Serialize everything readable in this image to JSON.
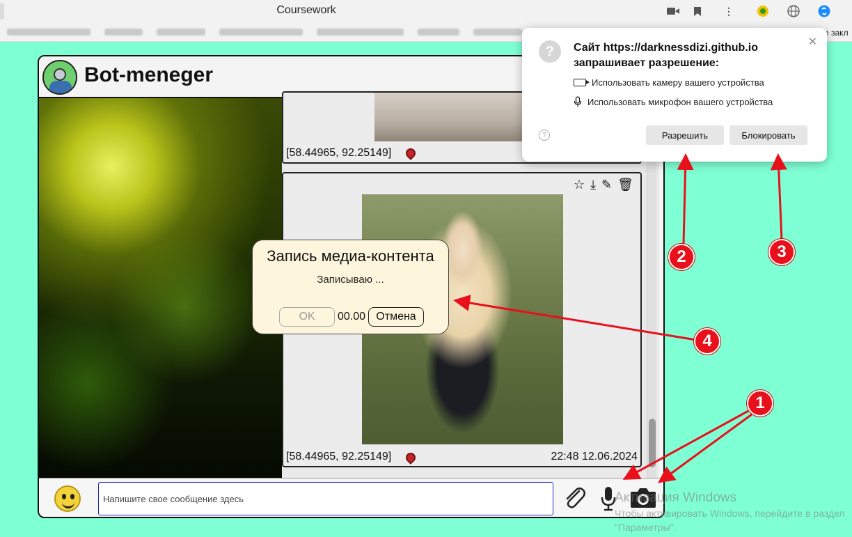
{
  "browser": {
    "title": "Coursework",
    "bookmarks_tail": "е закл"
  },
  "app": {
    "title": "Bot-meneger",
    "messages": [
      {
        "coords": "[58.44965, 92.25149]",
        "time": ""
      },
      {
        "coords": "[58.44965, 92.25149]",
        "time": "22:48 12.06.2024"
      }
    ],
    "input_placeholder": "Напишите свое сообщение здесь"
  },
  "permission_popup": {
    "title_line1": "Сайт https://darknessdizi.github.io",
    "title_line2": "запрашивает разрешение:",
    "camera": "Использовать камеру вашего устройства",
    "microphone": "Использовать микрофон вашего устройства",
    "allow": "Разрешить",
    "block": "Блокировать"
  },
  "record_dialog": {
    "title": "Запись медиа-контента",
    "status": "Записываю ...",
    "ok": "OK",
    "timer": "00.00",
    "cancel": "Отмена"
  },
  "watermark": {
    "line1": "Активация Windows",
    "line2": "Чтобы активировать Windows, перейдите в раздел",
    "line3": "\"Параметры\"."
  },
  "annotations": [
    "1",
    "2",
    "3",
    "4"
  ],
  "colors": {
    "page_bg": "#7fffd4",
    "annotation_red": "#e8101b",
    "dialog_bg": "#fdf6dd"
  }
}
